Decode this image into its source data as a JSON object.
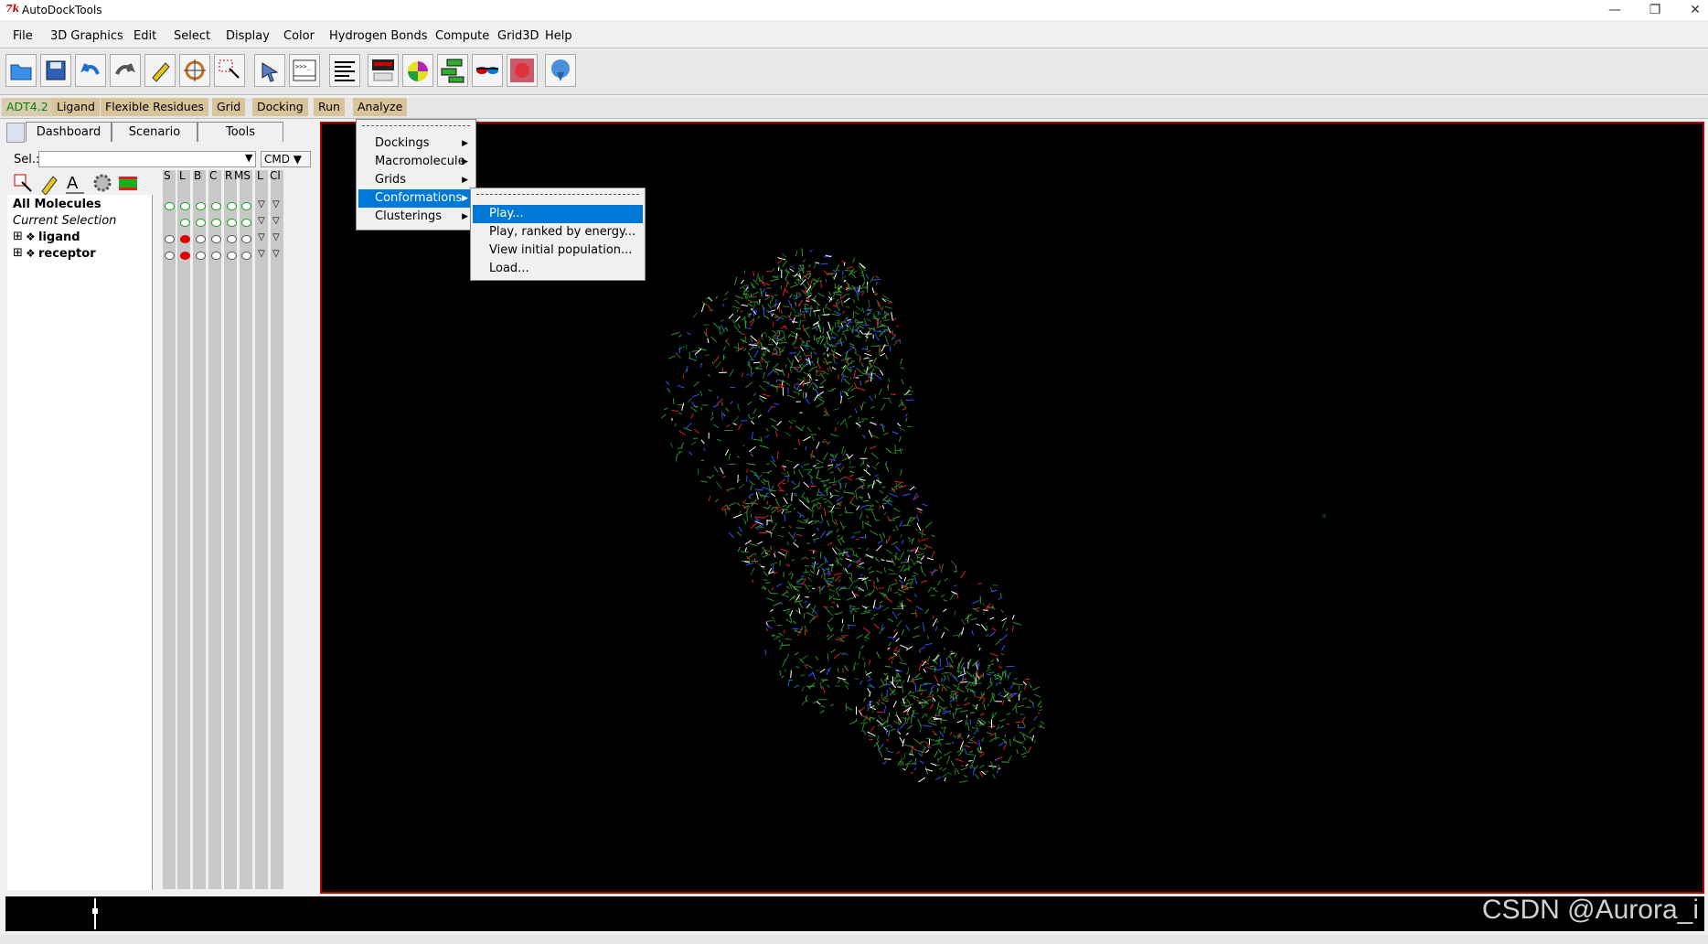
{
  "window": {
    "title": "AutoDockTools",
    "icon_text": "7k"
  },
  "menubar": [
    "File",
    "3D Graphics",
    "Edit",
    "Select",
    "Display",
    "Color",
    "Hydrogen Bonds",
    "Compute",
    "Grid3D",
    "Help"
  ],
  "toolbar_icons": [
    "open-file-icon",
    "save-icon",
    "undo-icon",
    "redo-icon",
    "pencil-icon",
    "center-target-icon",
    "select-icon",
    "pointer-icon",
    "python-shell-icon",
    "text-lines-icon",
    "ribbon-icon",
    "sphere-icon",
    "network-icon",
    "stereo-glasses-icon",
    "molecule-surface-icon",
    "dna-icon"
  ],
  "adt_menubar": {
    "version": "ADT4.2",
    "items": [
      "Ligand",
      "Flexible Residues",
      "Grid",
      "Docking",
      "Run",
      "Analyze"
    ]
  },
  "panel_tabs": [
    "Dashboard",
    "Scenario",
    "Tools"
  ],
  "selection": {
    "label": "Sel.:",
    "value": "",
    "cmd_label": "CMD"
  },
  "columns": [
    "S",
    "L",
    "B",
    "C",
    "R",
    "MS",
    "L",
    "Cl"
  ],
  "tree": {
    "all_molecules": "All Molecules",
    "current_selection": "Current Selection",
    "molecules": [
      {
        "name": "ligand"
      },
      {
        "name": "receptor"
      }
    ]
  },
  "analyze_menu": {
    "items": [
      {
        "label": "Dockings",
        "submenu": true
      },
      {
        "label": "Macromolecule",
        "submenu": true
      },
      {
        "label": "Grids",
        "submenu": true
      },
      {
        "label": "Conformations",
        "submenu": true,
        "active": true
      },
      {
        "label": "Clusterings",
        "submenu": true
      }
    ]
  },
  "conformations_menu": {
    "items": [
      {
        "label": "Play...",
        "active": true
      },
      {
        "label": "Play, ranked by energy..."
      },
      {
        "label": "View initial population..."
      },
      {
        "label": "Load..."
      }
    ]
  },
  "watermark": "CSDN @Aurora_i",
  "colors": {
    "highlight": "#0078d7",
    "viewer_bg": "#000000",
    "viewer_border": "#b00000",
    "adt_bar": "#d8c39a"
  }
}
